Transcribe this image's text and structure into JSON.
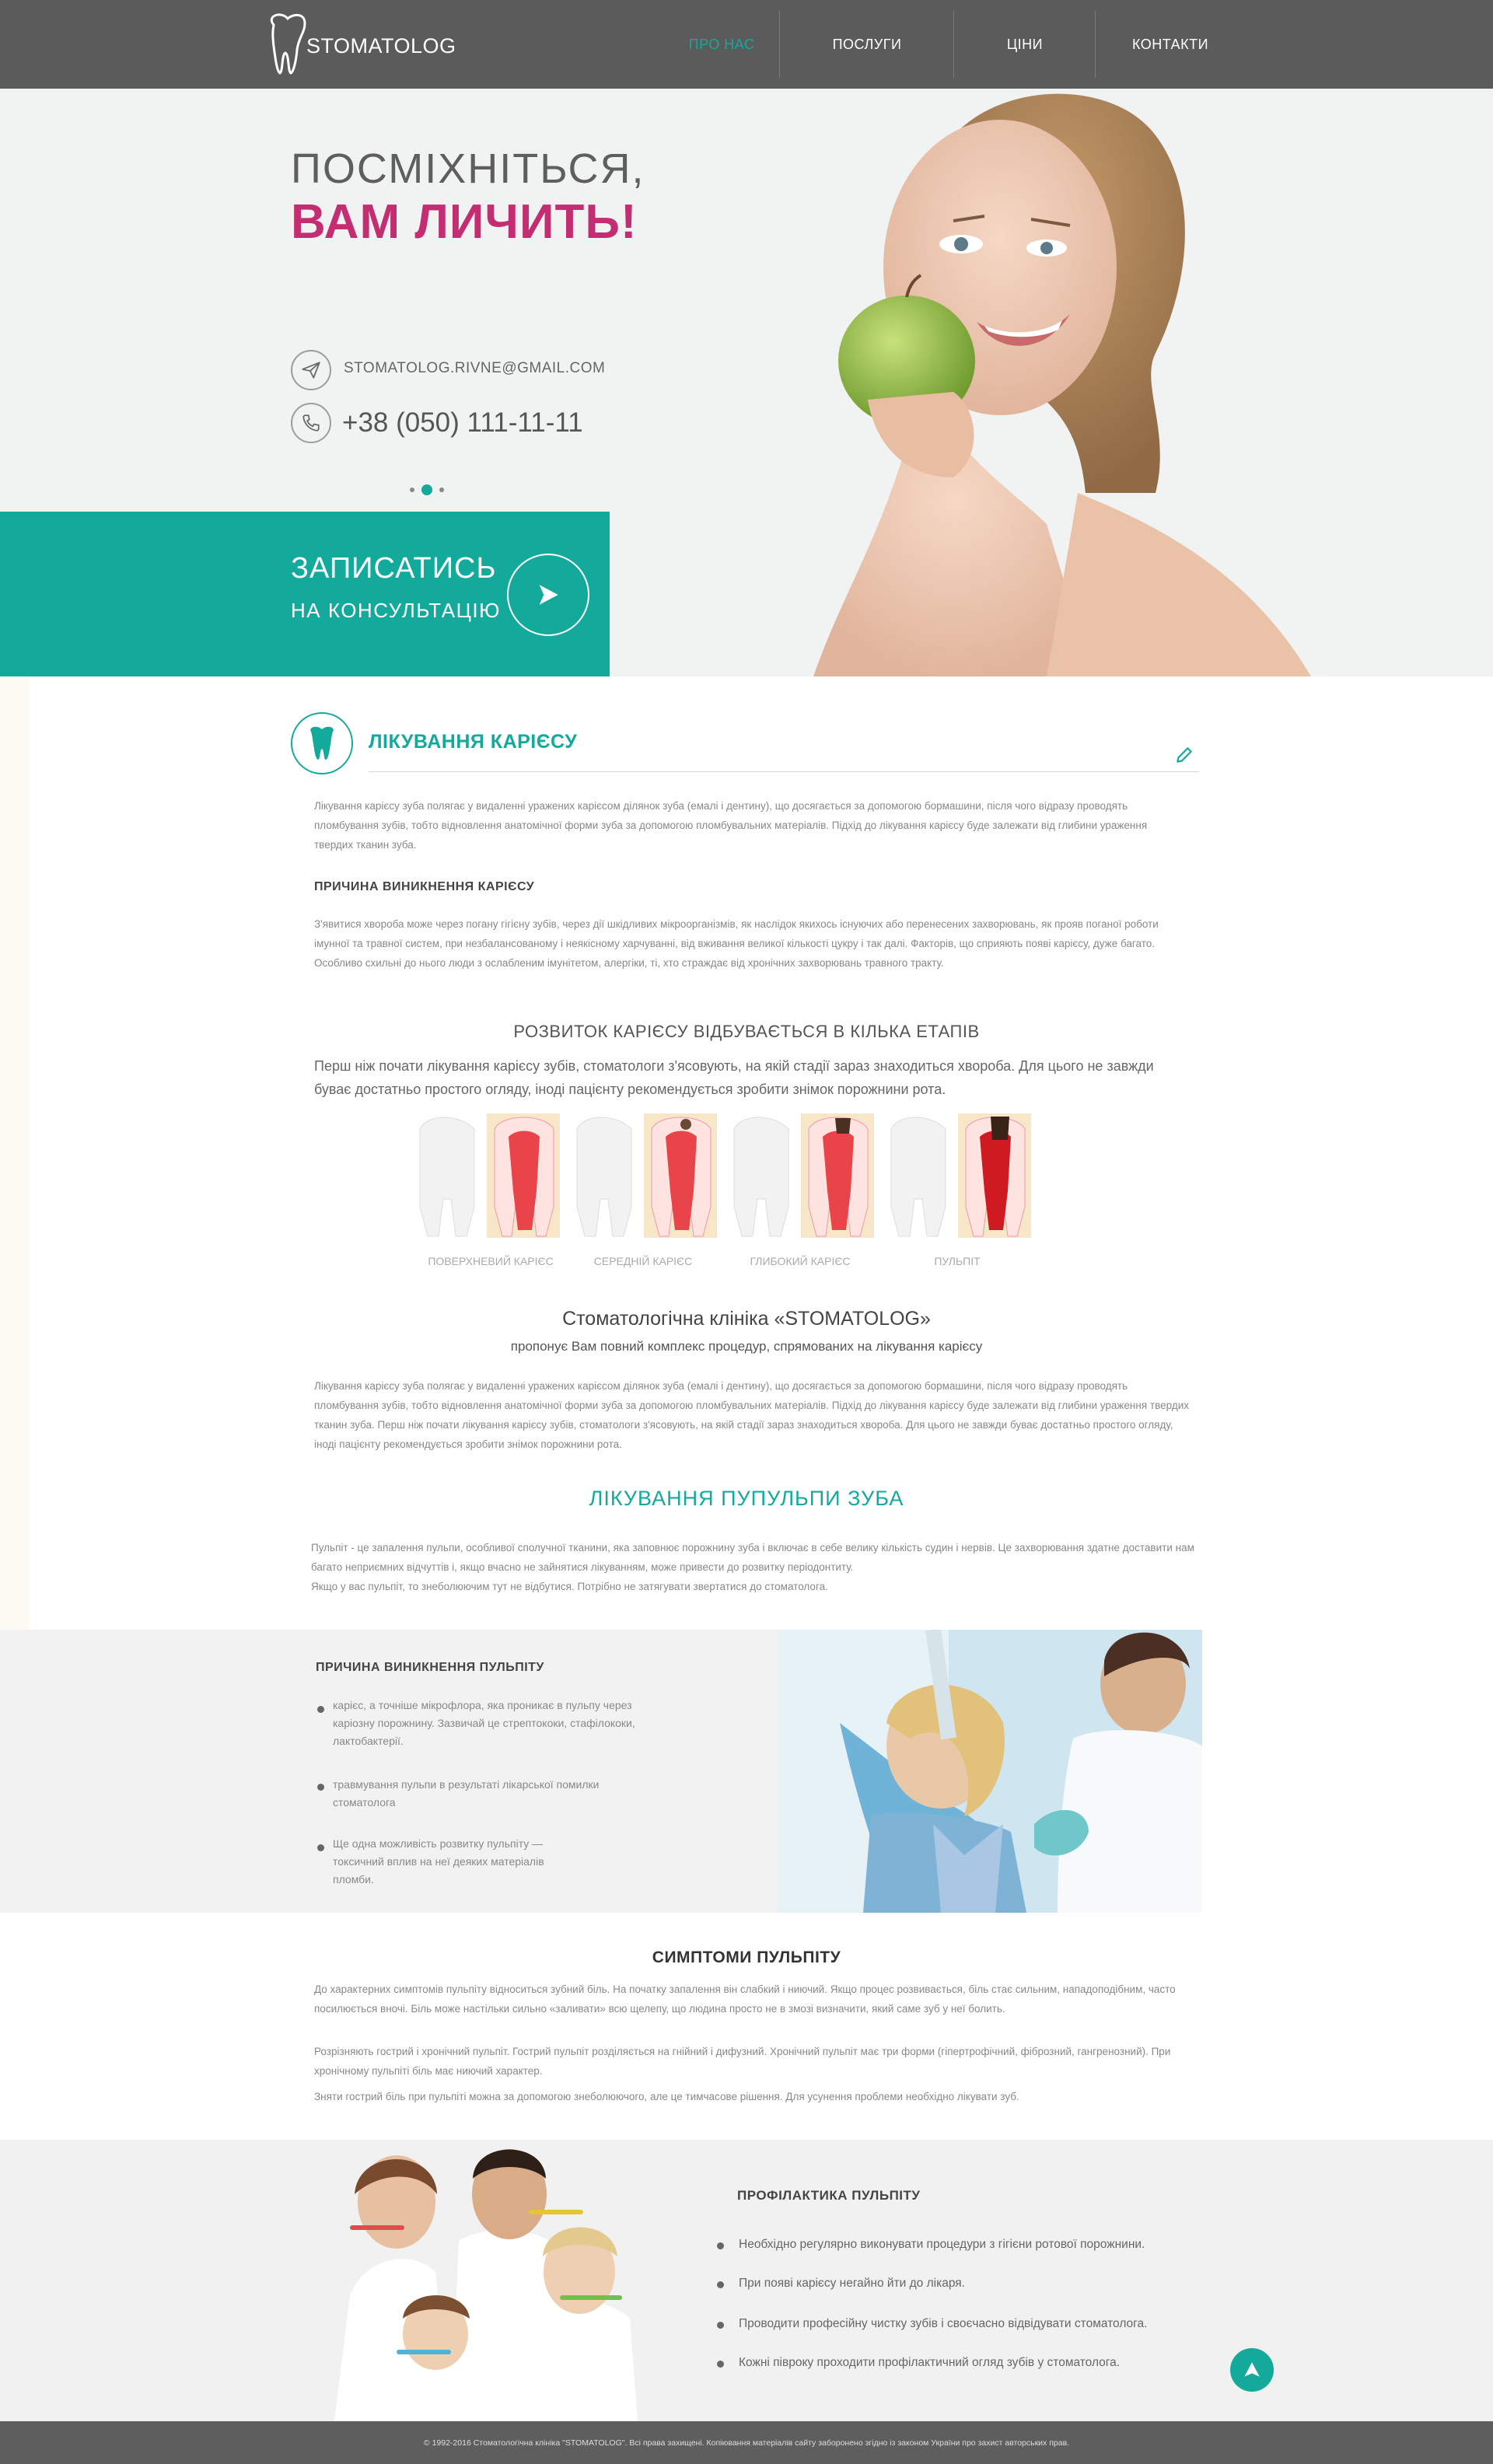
{
  "header": {
    "logo_text": "STOMATOLOG",
    "nav": [
      "ПРО НАС",
      "ПОСЛУГИ",
      "ЦІНИ",
      "КОНТАКТИ"
    ],
    "active_nav": "ПРО НАС"
  },
  "hero": {
    "title_line1": "ПОСМІХНІТЬСЯ,",
    "title_line2": "ВАМ ЛИЧИТЬ!",
    "email": "STOMATOLOG.RIVNE@GMAIL.COM",
    "phone": "+38 (050) 111-11-11",
    "cta_line1": "ЗАПИСАТИСЬ",
    "cta_line2": "НА КОНСУЛЬТАЦІЮ"
  },
  "article": {
    "title": "ЛІКУВАННЯ КАРІЄСУ",
    "intro": "Лікування карієсу зуба полягає у видаленні уражених карієсом ділянок зуба (емалі і дентину), що досягається за допомогою бормашини, після чого відразу проводять пломбування зубів, тобто відновлення анатомічної форми зуба за допомогою пломбувальних матеріалів. Підхід до лікування карієсу буде залежати від глибини ураження твердих тканин зуба.",
    "cause_title": "ПРИЧИНА ВИНИКНЕННЯ КАРІЄСУ",
    "cause_text": "З'явитися хвороба може через погану гігієну зубів, через дії шкідливих мікроорганізмів, як наслідок якихось існуючих або перенесених захворювань, як прояв поганої роботи імунної та травної систем, при незбалансованому і неякісному харчуванні, від вживання великої кількості цукру і так далі. Факторів, що сприяють появі карієсу, дуже багато. Особливо схильні до нього люди з ослабленим імунітетом, алергіки, ті, хто страждає від хронічних захворювань травного тракту.",
    "stages_title": "РОЗВИТОК КАРІЄСУ ВІДБУВАЄТЬСЯ В КІЛЬКА ЕТАПІВ",
    "stages_text": "Перш ніж почати лікування карієсу зубів, стоматологи з'ясовують, на якій стадії зараз знаходиться хвороба. Для цього не завжди буває достатньо простого огляду, іноді пацієнту рекомендується зробити знімок порожнини рота.",
    "stages": [
      "ПОВЕРХНЕВИЙ КАРІЄС",
      "СЕРЕДНІЙ КАРІЄС",
      "ГЛИБОКИЙ КАРІЄС",
      "ПУЛЬПІТ"
    ],
    "clinic_title": "Стоматологічна клініка «STOMATOLOG»",
    "clinic_sub": "пропонує Вам повний комплекс процедур, спрямованих на лікування карієсу",
    "clinic_text": "Лікування карієсу зуба полягає у видаленні уражених карієсом ділянок зуба (емалі і дентину), що досягається за допомогою бормашини, після чого відразу проводять пломбування зубів, тобто відновлення анатомічної форми зуба за допомогою пломбувальних матеріалів. Підхід до лікування карієсу буде залежати від глибини ураження твердих тканин зуба. Перш ніж почати лікування карієсу зубів, стоматологи з'ясовують, на якій стадії зараз знаходиться хвороба. Для цього не завжди буває достатньо простого огляду, іноді пацієнту рекомендується зробити знімок порожнини рота.",
    "pulp_title": "ЛІКУВАННЯ ПУПУЛЬПИ ЗУБА",
    "pulp_text1": "Пульпіт - це запалення пульпи, особливої сполучної тканини, яка заповнює порожнину зуба і включає в себе велику кількість судин і нервів. Це захворювання здатне доставити нам багато неприємних відчуттів і, якщо вчасно не зайнятися лікуванням, може привести до розвитку періодонтиту.",
    "pulp_text2": "Якщо у вас пульпіт, то знеболюючим тут не відбутися. Потрібно не затягувати звертатися до стоматолога."
  },
  "pulpitis_cause": {
    "title": "ПРИЧИНА ВИНИКНЕННЯ ПУЛЬПІТУ",
    "items": [
      "карієс, а точніше мікрофлора, яка проникає в пульпу через каріозну порожнину. Зазвичай це стрептококи, стафілококи, лактобактерії.",
      "травмування пульпи в результаті лікарської помилки стоматолога",
      "Ще одна можливість розвитку пульпіту — токсичний вплив на неї деяких матеріалів пломби."
    ]
  },
  "symptoms": {
    "title": "СИМПТОМИ ПУЛЬПІТУ",
    "p1": "До характерних симптомів пульпіту відноситься зубний біль. На початку запалення він слабкий і ниючий. Якщо процес розвивається, біль стає сильним, нападоподібним, часто посилюється вночі. Біль може настільки сильно «заливати» всю щелепу, що людина просто не в змозі визначити, який саме зуб у неї болить.",
    "p2": "Розрізняють гострий і хронічний пульпіт. Гострий пульпіт розділяється на гнійний і дифузний. Хронічний пульпіт має три форми (гіпертрофічний, фіброзний, гангренозний). При хронічному пульпіті біль має ниючий характер.",
    "p3": "Зняти гострий біль при пульпіті можна за допомогою знеболюючого, але це тимчасове рішення. Для усунення проблеми необхідно лікувати зуб."
  },
  "prevention": {
    "title": "ПРОФІЛАКТИКА ПУЛЬПІТУ",
    "items": [
      "Необхідно регулярно виконувати процедури з гігієни ротової порожнини.",
      "При появі карієсу негайно йти до лікаря.",
      "Проводити професійну чистку зубів і своєчасно відвідувати стоматолога.",
      "Кожні півроку проходити профілактичний огляд зубів у стоматолога."
    ]
  },
  "footer": {
    "text": "© 1992-2016 Стоматологічна клініка \"STOMATOLOG\". Всі права захищені. Копіювання матеріалів сайту заборонено згідно із законом України про захист авторських прав."
  },
  "colors": {
    "accent": "#13aa9b",
    "brand_pink": "#c32e73",
    "header": "#5b5b5b"
  },
  "icons": [
    "tooth-logo-icon",
    "paper-plane-icon",
    "phone-icon",
    "arrow-right-icon",
    "tooth-icon",
    "pencil-icon",
    "arrow-up-icon"
  ]
}
